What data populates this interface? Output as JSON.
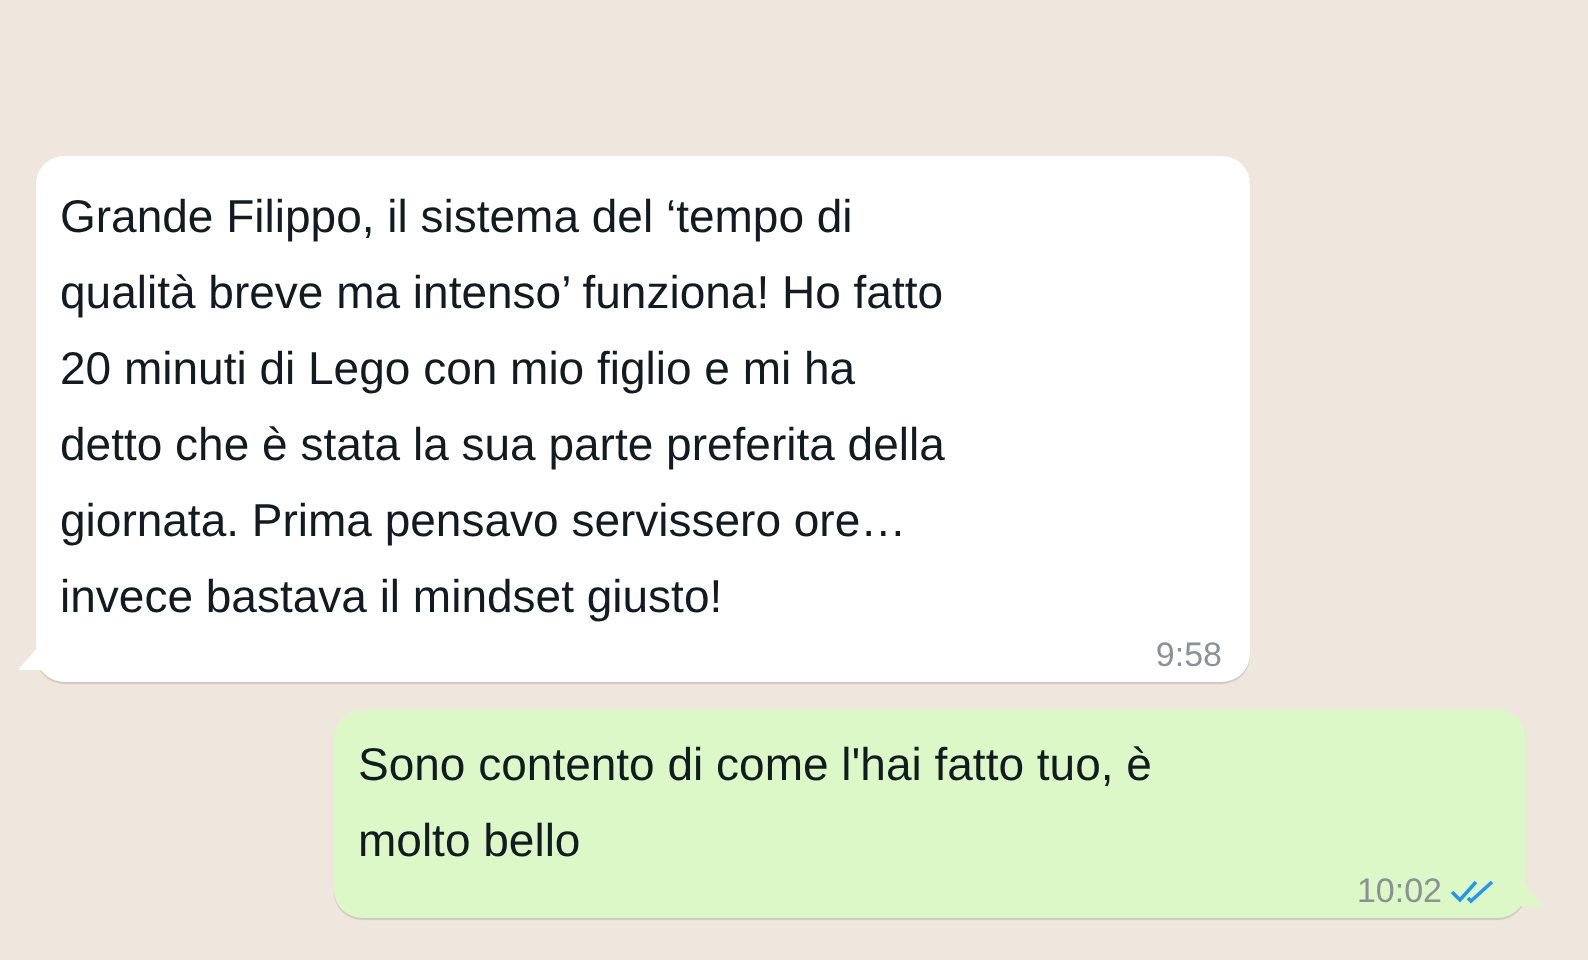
{
  "messages": [
    {
      "kind": "incoming",
      "text": "Grande Filippo, il sistema del ‘tempo di\nqualità breve ma intenso’ funziona! Ho fatto\n20 minuti di Lego con mio figlio e mi ha\ndetto che è stata la sua parte preferita della\ngiornata. Prima pensavo servissero ore…\ninvece bastava il mindset giusto!",
      "time": "9:58"
    },
    {
      "kind": "outgoing",
      "text": "Sono contento di come l'hai fatto tuo, è\nmolto bello",
      "time": "10:02",
      "read": true
    }
  ]
}
